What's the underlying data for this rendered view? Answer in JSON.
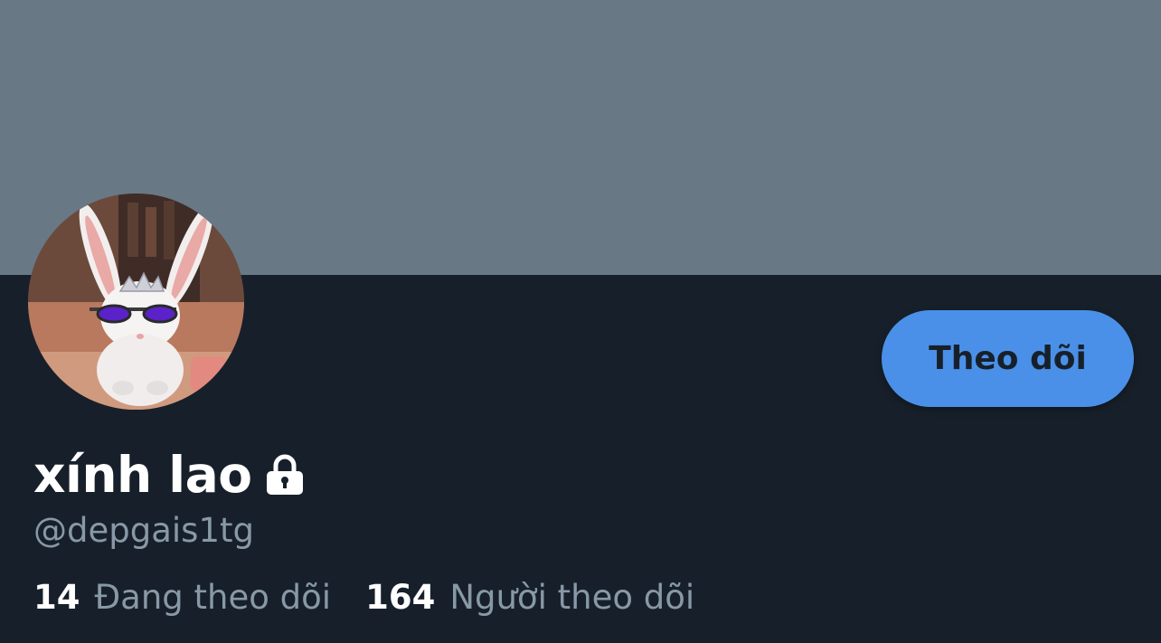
{
  "profile": {
    "display_name": "xính lao",
    "handle": "@depgais1tg",
    "protected_icon": "lock-icon",
    "avatar_description": "white-rabbit-with-sunglasses-and-tiara"
  },
  "actions": {
    "follow_label": "Theo dõi"
  },
  "stats": {
    "following_count": "14",
    "following_label": "Đang theo dõi",
    "followers_count": "164",
    "followers_label": "Người theo dõi"
  },
  "colors": {
    "banner": "#697885",
    "background": "#17202a",
    "accent": "#4a90e8",
    "secondary_text": "#8899a6"
  }
}
